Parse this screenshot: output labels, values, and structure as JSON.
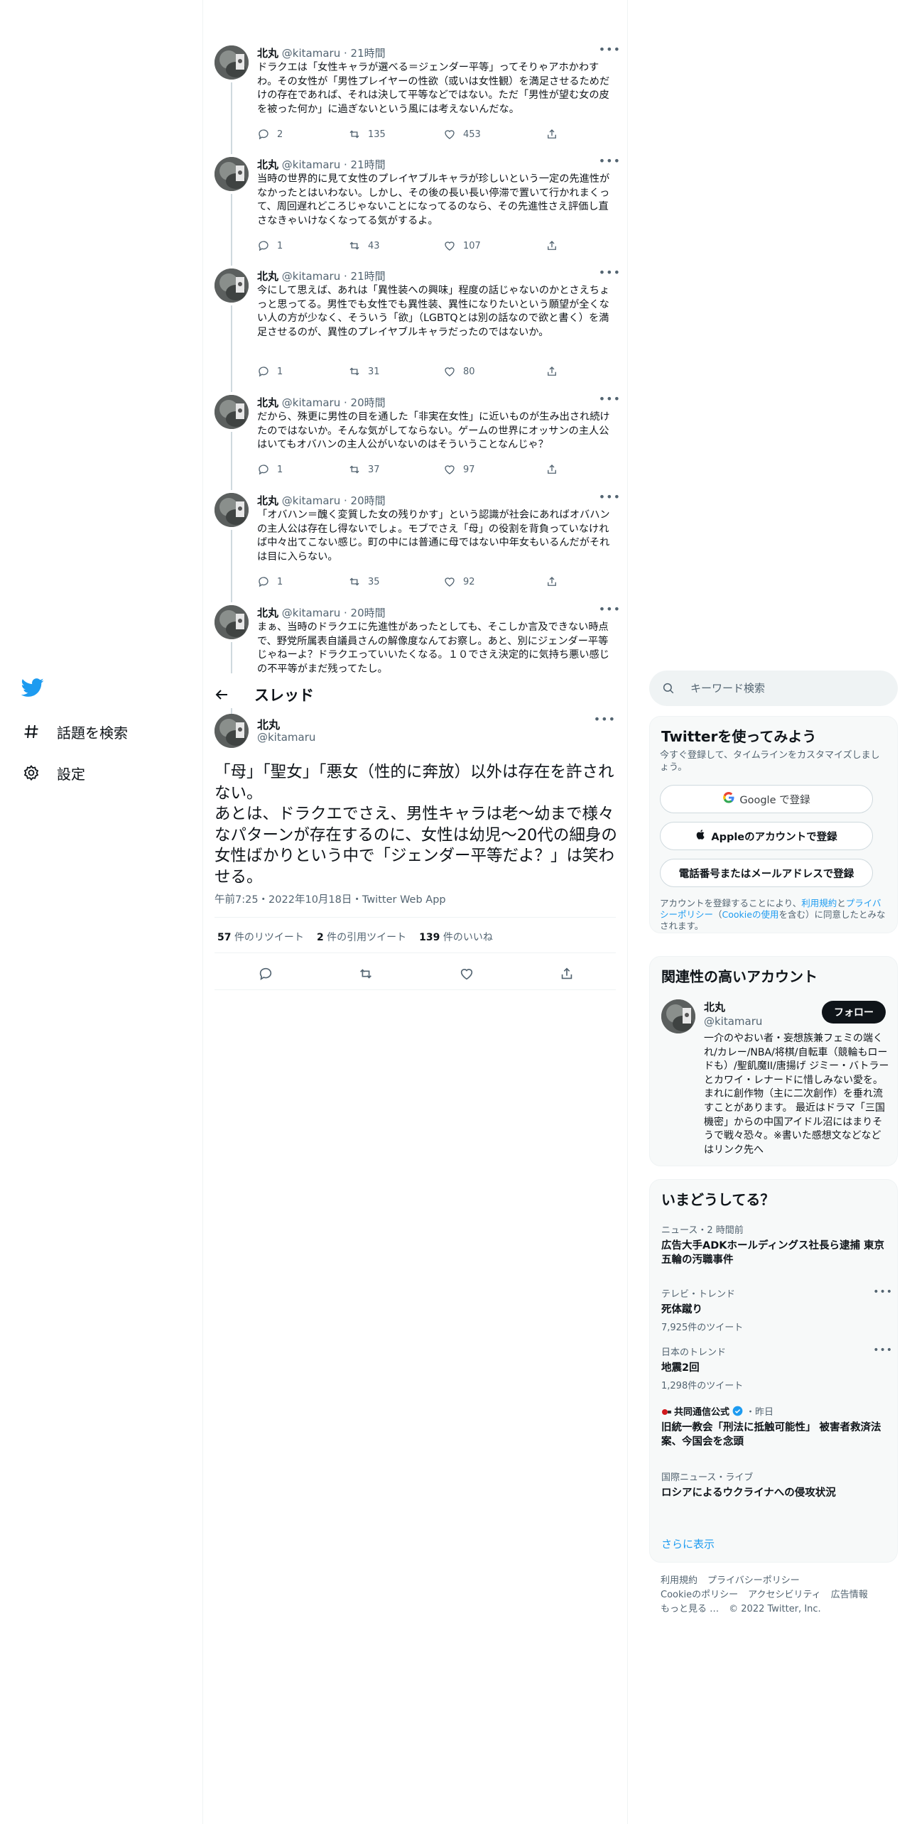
{
  "nav": {
    "logo": "twitter-bird-icon",
    "items": [
      {
        "label": "話題を検索",
        "icon": "hashtag-icon"
      },
      {
        "label": "設定",
        "icon": "gear-icon"
      }
    ]
  },
  "replies": [
    {
      "name": "北丸",
      "handle": "@kitamaru",
      "time": "21時間",
      "text": "ドラクエは「女性キャラが選べる＝ジェンダー平等」ってそりゃアホかわすわ。その女性が「男性プレイヤーの性欲（或いは女性観）を満足させるためだけの存在であれば、それは決して平等などではない。ただ「男性が望む女の皮を被った何か」に過ぎないという風には考えないんだな。",
      "replies": "2",
      "retweets": "135",
      "likes": "453"
    },
    {
      "name": "北丸",
      "handle": "@kitamaru",
      "time": "21時間",
      "text": "当時の世界的に見て女性のプレイヤブルキャラが珍しいという一定の先進性がなかったとはいわない。しかし、その後の長い長い停滞で置いて行かれまくって、周回遅れどころじゃないことになってるのなら、その先進性さえ評価し直さなきゃいけなくなってる気がするよ。",
      "replies": "1",
      "retweets": "43",
      "likes": "107"
    },
    {
      "name": "北丸",
      "handle": "@kitamaru",
      "time": "21時間",
      "text": "今にして思えば、あれは「異性装への興味」程度の話じゃないのかとさえちょっと思ってる。男性でも女性でも異性装、異性になりたいという願望が全くない人の方が少なく、そういう「欲」（LGBTQとは別の話なので欲と書く）を満足させるのが、異性のプレイヤブルキャラだったのではないか。",
      "replies": "1",
      "retweets": "31",
      "likes": "80"
    },
    {
      "name": "北丸",
      "handle": "@kitamaru",
      "time": "20時間",
      "text": "だから、殊更に男性の目を通した「非実在女性」に近いものが生み出され続けたのではないか。そんな気がしてならない。ゲームの世界にオッサンの主人公はいてもオバハンの主人公がいないのはそういうことなんじゃ？",
      "replies": "1",
      "retweets": "37",
      "likes": "97"
    },
    {
      "name": "北丸",
      "handle": "@kitamaru",
      "time": "20時間",
      "text": "「オバハン＝醜く変質した女の残りかす」という認識が社会にあればオバハンの主人公は存在し得ないでしょ。モブでさえ「母」の役割を背負っていなければ中々出てこない感じ。町の中には普通に母ではない中年女もいるんだがそれは目に入らない。",
      "replies": "1",
      "retweets": "35",
      "likes": "92"
    },
    {
      "name": "北丸",
      "handle": "@kitamaru",
      "time": "20時間",
      "text": "まぁ、当時のドラクエに先進性があったとしても、そこしか言及できない時点で、野党所属表自議員さんの解像度なんてお察し。あと、別にジェンダー平等じゃねーよ？ドラクエっていいたくなる。１０でさえ決定的に気持ち悪い感じの不平等がまだ残ってたし。",
      "replies": "",
      "retweets": "",
      "likes": ""
    }
  ],
  "thread": {
    "title": "スレッド",
    "main": {
      "name": "北丸",
      "handle": "@kitamaru",
      "text": "「母」「聖女」「悪女（性的に奔放）以外は存在を許されない。\nあとは、ドラクエでさえ、男性キャラは老～幼まで様々なパターンが存在するのに、女性は幼児～20代の細身の女性ばかりという中で「ジェンダー平等だよ？」は笑わせる。",
      "meta": "午前7:25・2022年10月18日・Twitter Web App",
      "retweets_num": "57",
      "retweets_label": "件のリツイート",
      "quotes_num": "2",
      "quotes_label": "件の引用ツイート",
      "likes_num": "139",
      "likes_label": "件のいいね"
    }
  },
  "search": {
    "placeholder": "キーワード検索"
  },
  "signup": {
    "title": "Twitterを使ってみよう",
    "subtitle": "今すぐ登録して、タイムラインをカスタマイズしましょう。",
    "google": "Google で登録",
    "apple": "Appleのアカウントで登録",
    "phone": "電話番号またはメールアドレスで登録",
    "legal_1": "アカウントを登録することにより、",
    "legal_terms": "利用規約",
    "legal_2": "と",
    "legal_privacy": "プライバシーポリシー",
    "legal_3": "（",
    "legal_cookie": "Cookieの使用",
    "legal_4": "を含む）に同意したとみなされます。"
  },
  "relevant": {
    "title": "関連性の高いアカウント",
    "name": "北丸",
    "handle": "@kitamaru",
    "follow": "フォロー",
    "bio": "一介のやおい者・妄想族兼フェミの端くれ/カレー/NBA/将棋/自転車（競輪もロードも）/聖飢魔II/唐揚げ ジミー・バトラーとカワイ・レナードに惜しみない愛を。まれに創作物（主に二次創作）を垂れ流すことがあります。 最近はドラマ「三国機密」からの中国アイドル沼にはまりそうで戦々恐々。※書いた感想文などなどはリンク先へ"
  },
  "trends": {
    "title": "いまどうしてる？",
    "items": [
      {
        "context": "ニュース・2 時間前",
        "title": "広告大手ADKホールディングス社長ら逮捕 東京五輪の汚職事件",
        "count": ""
      },
      {
        "context": "テレビ・トレンド",
        "title": "死体蹴り",
        "count": "7,925件のツイート"
      },
      {
        "context": "日本のトレンド",
        "title": "地震2回",
        "count": "1,298件のツイート"
      },
      {
        "context_source": "共同通信公式",
        "context_time": "・昨日",
        "title": "旧統一教会「刑法に抵触可能性」 被害者救済法案、今国会を念頭",
        "count": ""
      },
      {
        "context": "国際ニュース・ライブ",
        "title": "ロシアによるウクライナへの侵攻状況",
        "count": ""
      }
    ],
    "show_more": "さらに表示"
  },
  "footer": {
    "links": [
      "利用規約",
      "プライバシーポリシー",
      "Cookieのポリシー",
      "アクセシビリティ",
      "広告情報",
      "もっと見る …"
    ],
    "copyright": "© 2022 Twitter, Inc."
  },
  "colors": {
    "accent": "#1d9bf0",
    "text": "#0f1419",
    "muted": "#536471",
    "border": "#eff3f4"
  }
}
